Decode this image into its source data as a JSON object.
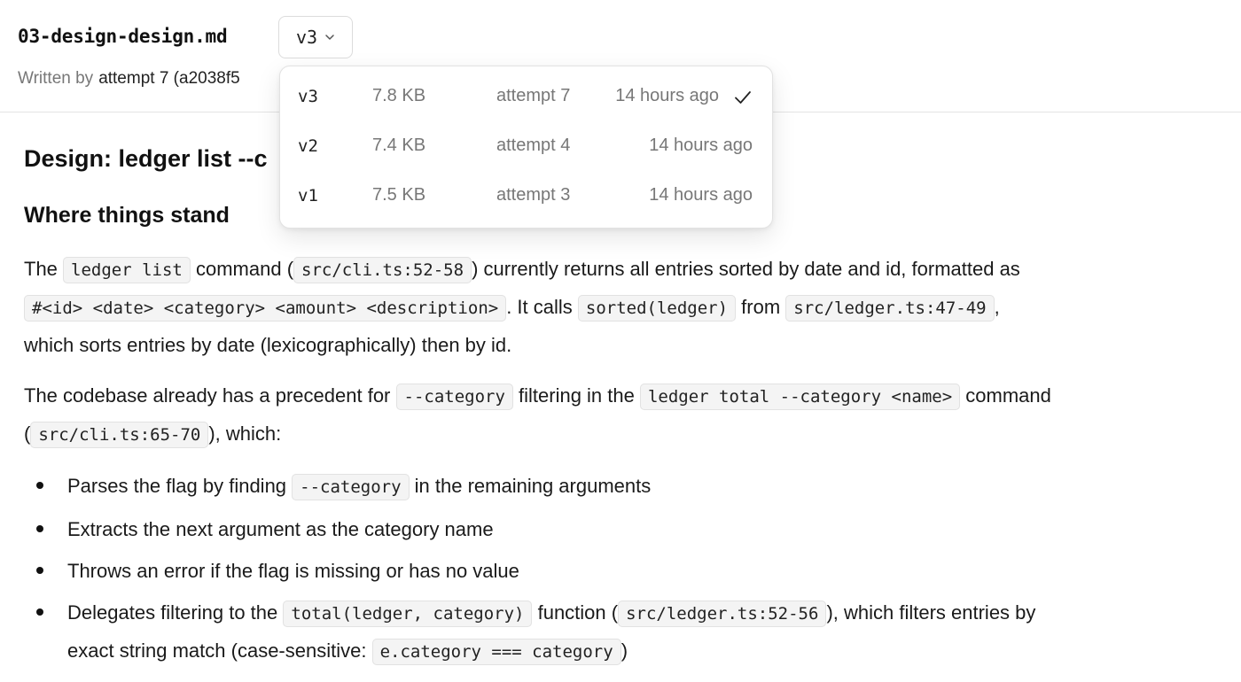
{
  "header": {
    "filename": "03-design-design.md",
    "version_selected": "v3",
    "written_by_label": "Written by",
    "author": "attempt 7 (a2038f5"
  },
  "versions": [
    {
      "version": "v3",
      "size": "7.8 KB",
      "attempt": "attempt 7",
      "time": "14 hours ago",
      "selected": true
    },
    {
      "version": "v2",
      "size": "7.4 KB",
      "attempt": "attempt 4",
      "time": "14 hours ago",
      "selected": false
    },
    {
      "version": "v1",
      "size": "7.5 KB",
      "attempt": "attempt 3",
      "time": "14 hours ago",
      "selected": false
    }
  ],
  "doc": {
    "title": "Design: ledger list --c",
    "section_heading": "Where things stand",
    "p1": {
      "t1": "The ",
      "c1": "ledger list",
      "t2": " command (",
      "c2": "src/cli.ts:52-58",
      "t3": ") currently returns all entries sorted by date and id, formatted as ",
      "c3": "#<id> <date> <category> <amount> <description>",
      "t4": ". It calls ",
      "c4": "sorted(ledger)",
      "t5": " from ",
      "c5": "src/ledger.ts:47-49",
      "t6": ", which sorts entries by date (lexicographically) then by id."
    },
    "p2": {
      "t1": "The codebase already has a precedent for ",
      "c1": "--category",
      "t2": " filtering in the ",
      "c2": "ledger total --category <name>",
      "t3": " command (",
      "c3": "src/cli.ts:65-70",
      "t4": "), which:"
    },
    "bullets": {
      "b1": {
        "t1": "Parses the flag by finding ",
        "c1": "--category",
        "t2": " in the remaining arguments"
      },
      "b2": {
        "t1": "Extracts the next argument as the category name"
      },
      "b3": {
        "t1": "Throws an error if the flag is missing or has no value"
      },
      "b4": {
        "t1": "Delegates filtering to the ",
        "c1": "total(ledger, category)",
        "t2": " function (",
        "c2": "src/ledger.ts:52-56",
        "t3": "), which filters entries by exact string match (case-sensitive: ",
        "c3": "e.category === category",
        "t4": ")"
      }
    }
  },
  "icons": {
    "dropdown": "chevron-down-icon",
    "selected": "check-icon"
  }
}
